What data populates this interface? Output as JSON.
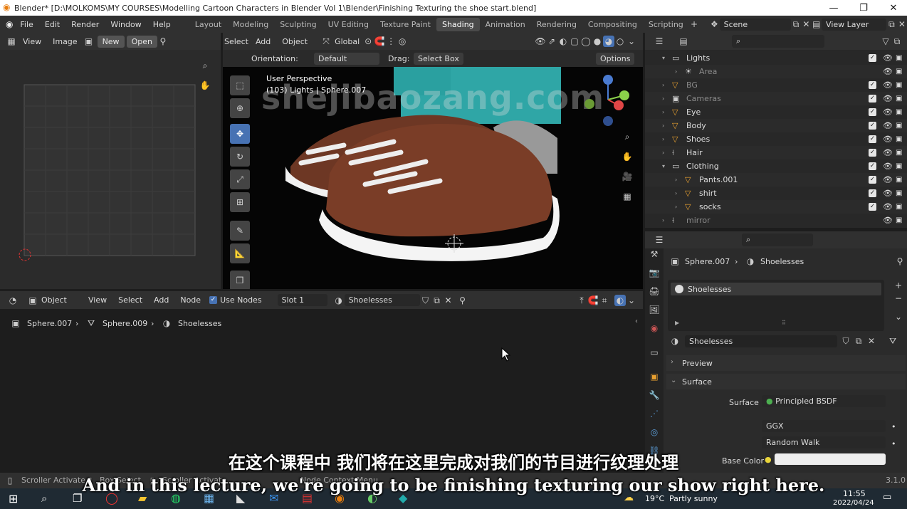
{
  "window": {
    "title": "Blender* [D:\\MOLKOMS\\MY COURSES\\Modelling  Cartoon Characters in Blender Vol 1\\Blender\\Finishing Texturing the shoe start.blend]",
    "minimize": "—",
    "maximize": "❐",
    "close": "✕"
  },
  "menu": [
    "File",
    "Edit",
    "Render",
    "Window",
    "Help"
  ],
  "workspaces": [
    "Layout",
    "Modeling",
    "Sculpting",
    "UV Editing",
    "Texture Paint",
    "Shading",
    "Animation",
    "Rendering",
    "Compositing",
    "Scripting"
  ],
  "active_workspace": "Shading",
  "scene": {
    "label": "Scene",
    "view_layer": "View Layer"
  },
  "image_editor": {
    "view": "View",
    "image": "Image",
    "new": "New",
    "open": "Open"
  },
  "viewport": {
    "menus": [
      "Select",
      "Add",
      "Object"
    ],
    "orientation_label": "Orientation:",
    "orientation_value": "Default",
    "drag_label": "Drag:",
    "drag_value": "Select Box",
    "transform_space": "Global",
    "options": "Options",
    "info_line1": "User Perspective",
    "info_line2": "(103) Lights | Sphere.007",
    "watermark": "shejibaozang.com"
  },
  "outliner": {
    "rows": [
      {
        "name": "Lights",
        "muted": false
      },
      {
        "name": "Area",
        "muted": true
      },
      {
        "name": "BG",
        "muted": true
      },
      {
        "name": "Cameras",
        "muted": true
      },
      {
        "name": "Eye",
        "muted": false
      },
      {
        "name": "Body",
        "muted": false
      },
      {
        "name": "Shoes",
        "muted": false
      },
      {
        "name": "Hair",
        "muted": false
      },
      {
        "name": "Clothing",
        "muted": false
      },
      {
        "name": "Pants.001",
        "muted": false
      },
      {
        "name": "shirt",
        "muted": false
      },
      {
        "name": "socks",
        "muted": false
      },
      {
        "name": "mirror",
        "muted": true
      }
    ]
  },
  "properties": {
    "breadcrumb_object": "Sphere.007",
    "breadcrumb_material": "Shoelesses",
    "slot_name": "Shoelesses",
    "material_name": "Shoelesses",
    "preview": "Preview",
    "surface_panel": "Surface",
    "surface_label": "Surface",
    "surface_value": "Principled BSDF",
    "distribution": "GGX",
    "subsurface": "Random Walk",
    "base_color_label": "Base Color"
  },
  "node_editor": {
    "mode": "Object",
    "menus": [
      "View",
      "Select",
      "Add",
      "Node"
    ],
    "use_nodes": "Use Nodes",
    "slot": "Slot 1",
    "material": "Shoelesses",
    "breadcrumb": [
      "Sphere.007",
      "Sphere.009",
      "Shoelesses"
    ]
  },
  "status": {
    "left": "Scroller Activate",
    "mid": "Box Select",
    "mid2": "Scroller Activate",
    "node_menu": "Node Context Menu",
    "version": "3.1.0"
  },
  "subtitles": {
    "zh": "在这个课程中 我们将在这里完成对我们的节目进行纹理处理",
    "en": "And in this lecture, we're going to be finishing texturing our show right here."
  },
  "taskbar": {
    "weather_temp": "19°C",
    "weather_desc": "Partly sunny",
    "time": "11:55",
    "date": "2022/04/24"
  }
}
